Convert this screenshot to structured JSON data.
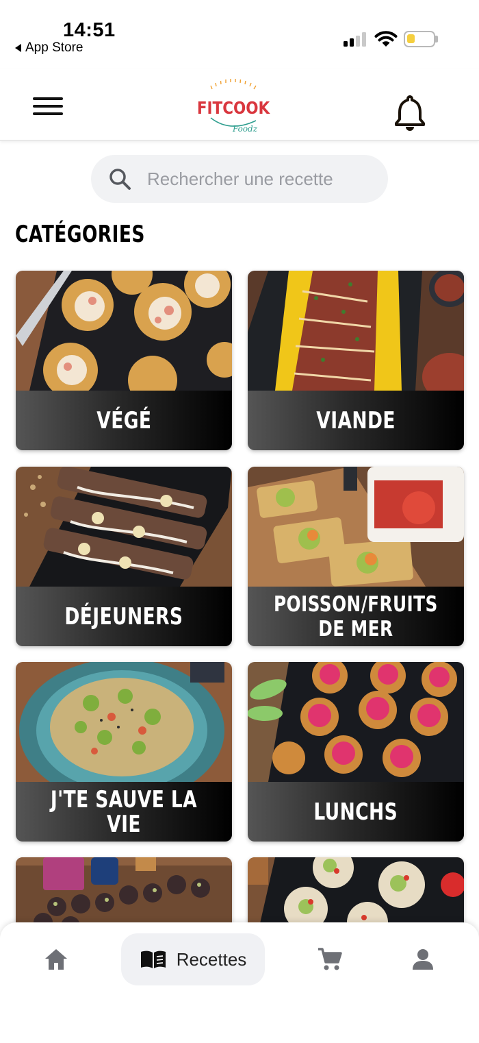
{
  "status_bar": {
    "time": "14:51",
    "back_label": "App Store",
    "battery_color": "#f5cf3f"
  },
  "header": {
    "menu_icon": "hamburger-menu-icon",
    "logo_main": "FITCOOK",
    "logo_sub": "Foodz",
    "logo_colors": {
      "main": "#d9363e",
      "sub": "#2f9e8f",
      "rays": "#f0a030"
    },
    "bell_icon": "bell-icon"
  },
  "search": {
    "placeholder": "Rechercher une recette"
  },
  "section": {
    "title": "CATÉGORIES"
  },
  "categories": [
    {
      "label": "VÉGÉ"
    },
    {
      "label": "VIANDE"
    },
    {
      "label": "DÉJEUNERS"
    },
    {
      "label": "POISSON/FRUITS DE MER"
    },
    {
      "label": "J'TE SAUVE LA VIE"
    },
    {
      "label": "LUNCHS"
    },
    {
      "label": ""
    },
    {
      "label": ""
    }
  ],
  "bottom_nav": {
    "home_icon": "home-icon",
    "recipes_icon": "recipe-book-icon",
    "recipes_label": "Recettes",
    "cart_icon": "cart-icon",
    "profile_icon": "profile-icon",
    "active": "Recettes"
  }
}
